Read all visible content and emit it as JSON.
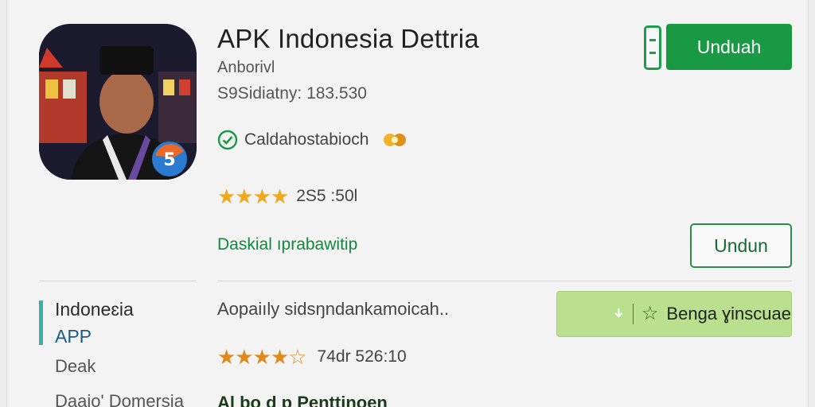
{
  "app": {
    "title": "APK Indonesia Dettria",
    "developer": "Anborivl",
    "downloads": "S9Sidiatny: 183.530",
    "verified_label": "Caldahostabioch",
    "rating_stars": "★★★★",
    "rating_text": "2S5 :50l",
    "link_text": "Daskial ıprabawitip"
  },
  "buttons": {
    "primary_label": "Unduah",
    "outline_label": "Undun",
    "light_label": "Benga ɣinscuae"
  },
  "sidebar": {
    "title": "Indoneɛia",
    "subtitle": "APP",
    "item_1": "Deak",
    "item_2": "Daaio' Domersia"
  },
  "section2": {
    "description": "Aopaiıly sidsŋndankamoicah..",
    "stars": "★★★★☆",
    "rating_text": "74dr 526:10",
    "bottom_label": "Al bo d p Penttinoen"
  },
  "colors": {
    "primary_green": "#1a9944",
    "link_green": "#0d8a3e",
    "light_green": "#b9e08f",
    "star_gold": "#f0a81c",
    "accent_teal": "#3fb0a8"
  },
  "icons": [
    "app-icon",
    "check-circle-icon",
    "badge-icon",
    "phone-icon",
    "download-icon",
    "star-outline-icon"
  ]
}
